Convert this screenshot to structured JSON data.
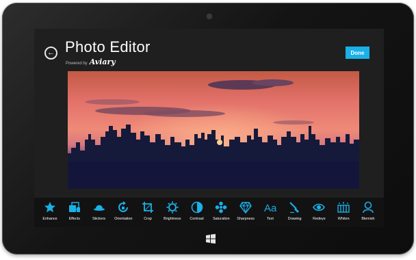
{
  "header": {
    "title": "Photo Editor",
    "powered_by": "Powered by",
    "brand": "Aviary",
    "done_label": "Done"
  },
  "colors": {
    "accent": "#1ab0e8",
    "background": "#1f1f1f",
    "toolbar": "#121212"
  },
  "tools": [
    {
      "label": "Enhance",
      "icon": "star-icon"
    },
    {
      "label": "Effects",
      "icon": "effects-icon"
    },
    {
      "label": "Stickers",
      "icon": "hat-icon"
    },
    {
      "label": "Orientation",
      "icon": "rotate-icon"
    },
    {
      "label": "Crop",
      "icon": "crop-icon"
    },
    {
      "label": "Brightness",
      "icon": "sun-icon"
    },
    {
      "label": "Contrast",
      "icon": "contrast-icon"
    },
    {
      "label": "Saturation",
      "icon": "saturation-icon"
    },
    {
      "label": "Sharpness",
      "icon": "diamond-icon"
    },
    {
      "label": "Text",
      "icon": "text-icon"
    },
    {
      "label": "Drawing",
      "icon": "brush-icon"
    },
    {
      "label": "Redeye",
      "icon": "eye-icon"
    },
    {
      "label": "Whiten",
      "icon": "whiten-icon"
    },
    {
      "label": "Blemish",
      "icon": "blemish-icon"
    }
  ]
}
